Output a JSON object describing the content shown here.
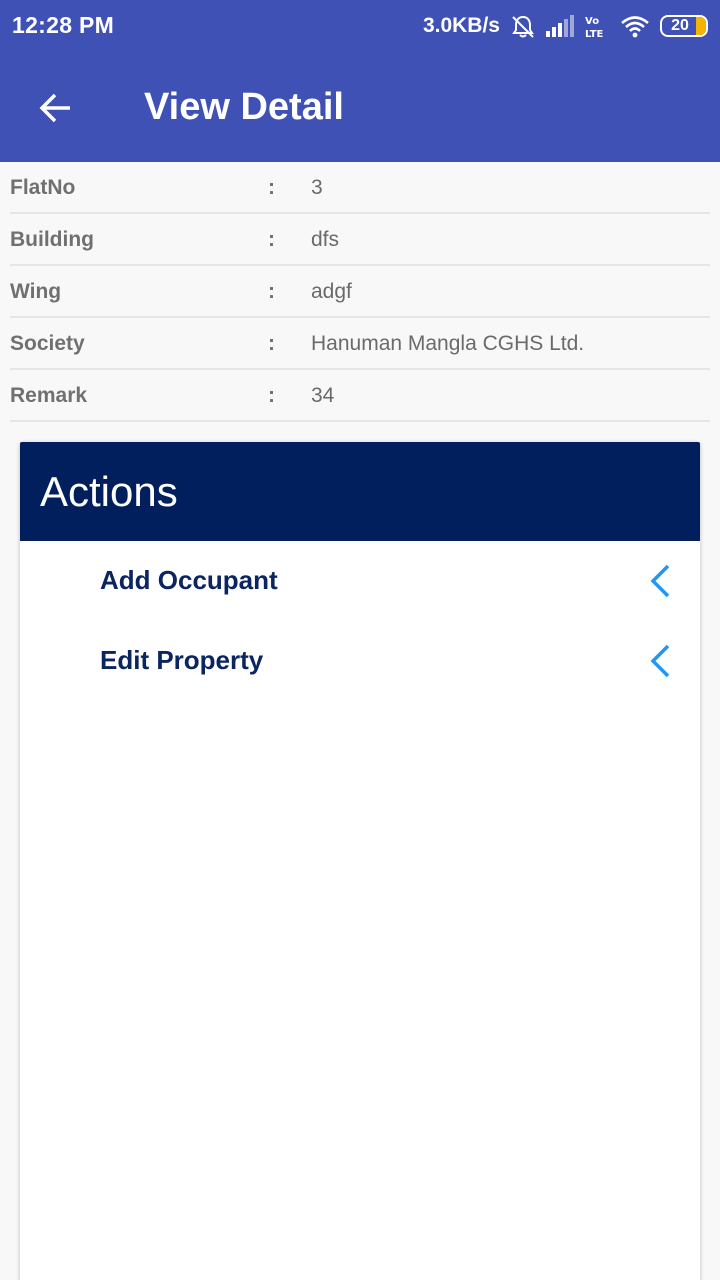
{
  "status_bar": {
    "time": "12:28 PM",
    "net_speed": "3.0KB/s",
    "lte_label": "Vo LTE",
    "battery": "20",
    "icons": [
      "mute-alarm-icon",
      "signal-icon",
      "volte-icon",
      "wifi-icon",
      "battery-icon"
    ]
  },
  "header": {
    "title": "View Detail",
    "back_icon": "arrow-left-icon",
    "color": "#3f51b5"
  },
  "details": [
    {
      "label": "FlatNo",
      "separator": ":",
      "value": "3"
    },
    {
      "label": "Building",
      "separator": ":",
      "value": "dfs"
    },
    {
      "label": "Wing",
      "separator": ":",
      "value": "adgf"
    },
    {
      "label": "Society",
      "separator": ":",
      "value": "Hanuman Mangla CGHS Ltd."
    },
    {
      "label": "Remark",
      "separator": ":",
      "value": "34"
    }
  ],
  "actions": {
    "title": "Actions",
    "header_color": "#001f5c",
    "items": [
      {
        "label": "Add Occupant",
        "icon": "chevron-left-icon"
      },
      {
        "label": "Edit Property",
        "icon": "chevron-left-icon"
      }
    ],
    "chevron_color": "#2196f3"
  }
}
